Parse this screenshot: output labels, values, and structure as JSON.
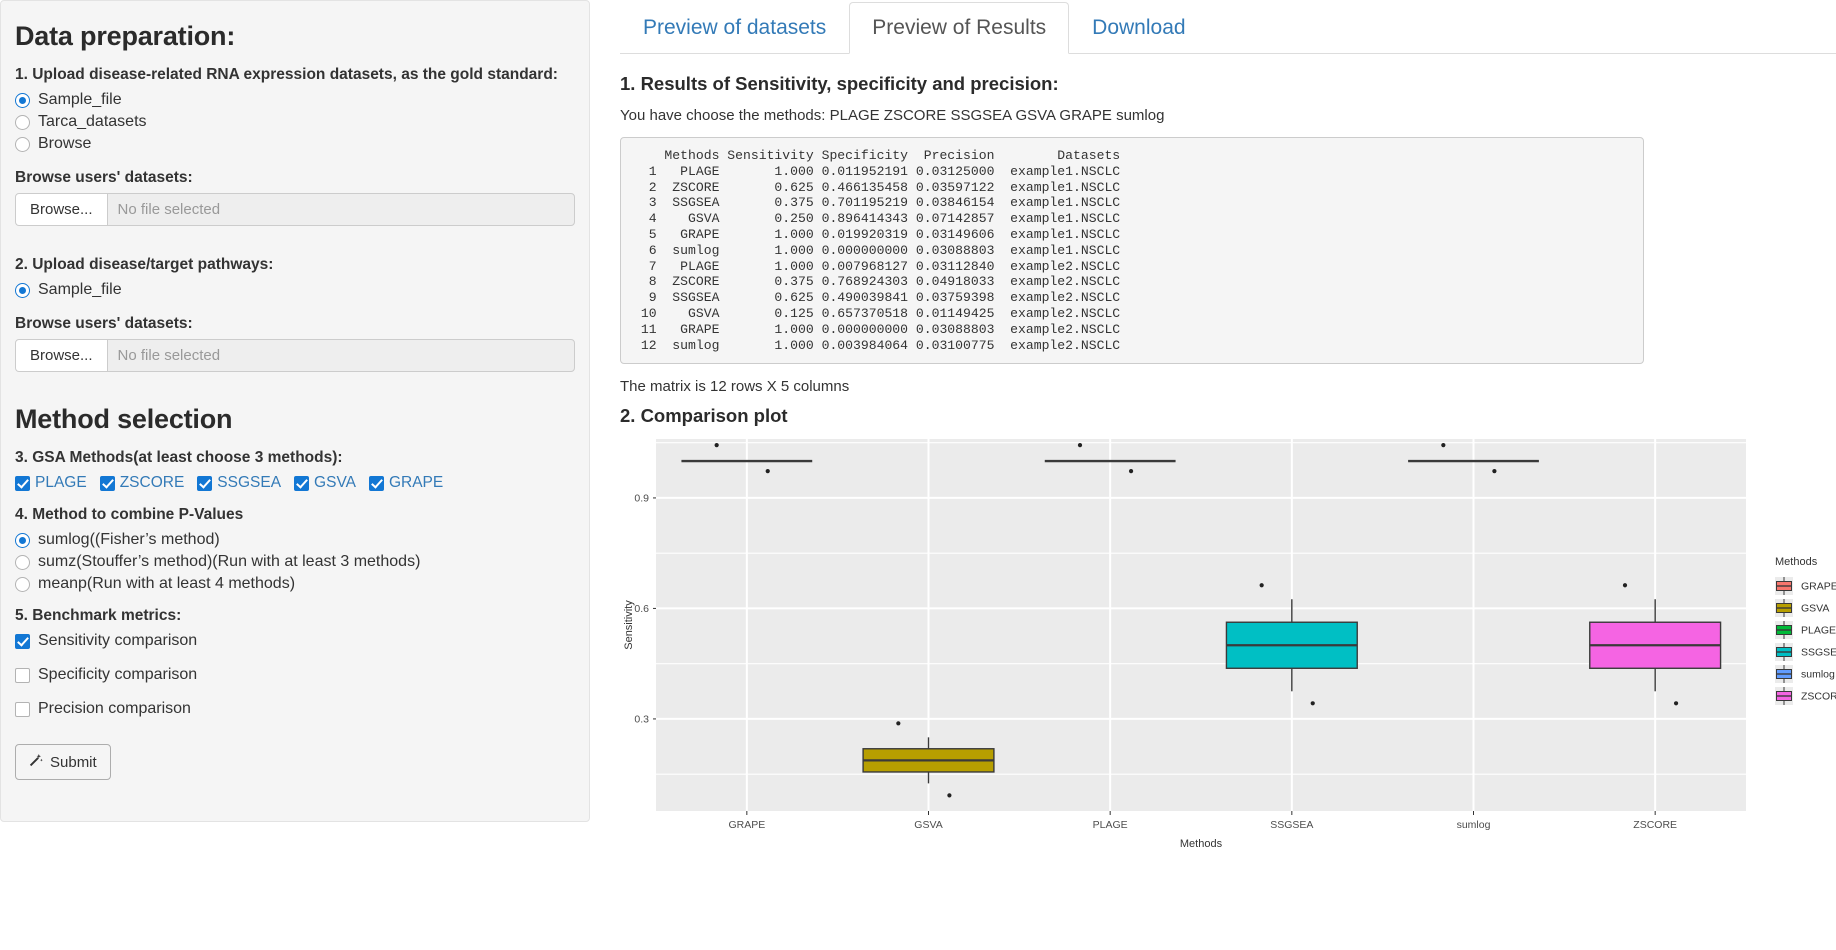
{
  "sidebar": {
    "title": "Data preparation:",
    "q1_label": "1. Upload disease-related RNA expression datasets, as the gold standard:",
    "q1_options": [
      {
        "label": "Sample_file",
        "selected": true
      },
      {
        "label": "Tarca_datasets",
        "selected": false
      },
      {
        "label": "Browse",
        "selected": false
      }
    ],
    "browse1_label": "Browse users' datasets:",
    "browse1_button": "Browse...",
    "browse1_placeholder": "No file selected",
    "q2_label": "2. Upload disease/target pathways:",
    "q2_options": [
      {
        "label": "Sample_file",
        "selected": true
      }
    ],
    "browse2_label": "Browse users' datasets:",
    "browse2_button": "Browse...",
    "browse2_placeholder": "No file selected",
    "method_title": "Method selection",
    "q3_label": "3. GSA Methods(at least choose 3 methods):",
    "q3_options": [
      {
        "label": "PLAGE",
        "checked": true
      },
      {
        "label": "ZSCORE",
        "checked": true
      },
      {
        "label": "SSGSEA",
        "checked": true
      },
      {
        "label": "GSVA",
        "checked": true
      },
      {
        "label": "GRAPE",
        "checked": true
      }
    ],
    "q4_label": "4. Method to combine P-Values",
    "q4_options": [
      {
        "label": "sumlog((Fisher’s method)",
        "selected": true
      },
      {
        "label": "sumz(Stouffer’s method)(Run with at least 3 methods)",
        "selected": false
      },
      {
        "label": "meanp(Run with at least 4 methods)",
        "selected": false
      }
    ],
    "q5_label": "5. Benchmark metrics:",
    "q5_options": [
      {
        "label": "Sensitivity comparison",
        "checked": true
      },
      {
        "label": "Specificity comparison",
        "checked": false
      },
      {
        "label": "Precision comparison",
        "checked": false
      }
    ],
    "submit_label": "Submit",
    "submit_icon": "wand-icon"
  },
  "tabs": [
    {
      "label": "Preview of datasets",
      "active": false
    },
    {
      "label": "Preview of Results",
      "active": true
    },
    {
      "label": "Download",
      "active": false
    }
  ],
  "results": {
    "heading": "1. Results of Sensitivity, specificity and precision:",
    "methods_note": "You have choose the methods: PLAGE ZSCORE SSGSEA GSVA GRAPE sumlog",
    "matrix_note": "The matrix is 12 rows X 5 columns",
    "table": {
      "columns": [
        "",
        "Methods",
        "Sensitivity",
        "Specificity",
        "Precision",
        "Datasets"
      ],
      "rows": [
        [
          "1",
          "PLAGE",
          "1.000",
          "0.011952191",
          "0.03125000",
          "example1.NSCLC"
        ],
        [
          "2",
          "ZSCORE",
          "0.625",
          "0.466135458",
          "0.03597122",
          "example1.NSCLC"
        ],
        [
          "3",
          "SSGSEA",
          "0.375",
          "0.701195219",
          "0.03846154",
          "example1.NSCLC"
        ],
        [
          "4",
          "GSVA",
          "0.250",
          "0.896414343",
          "0.07142857",
          "example1.NSCLC"
        ],
        [
          "5",
          "GRAPE",
          "1.000",
          "0.019920319",
          "0.03149606",
          "example1.NSCLC"
        ],
        [
          "6",
          "sumlog",
          "1.000",
          "0.000000000",
          "0.03088803",
          "example1.NSCLC"
        ],
        [
          "7",
          "PLAGE",
          "1.000",
          "0.007968127",
          "0.03112840",
          "example2.NSCLC"
        ],
        [
          "8",
          "ZSCORE",
          "0.375",
          "0.768924303",
          "0.04918033",
          "example2.NSCLC"
        ],
        [
          "9",
          "SSGSEA",
          "0.625",
          "0.490039841",
          "0.03759398",
          "example2.NSCLC"
        ],
        [
          "10",
          "GSVA",
          "0.125",
          "0.657370518",
          "0.01149425",
          "example2.NSCLC"
        ],
        [
          "11",
          "GRAPE",
          "1.000",
          "0.000000000",
          "0.03088803",
          "example2.NSCLC"
        ],
        [
          "12",
          "sumlog",
          "1.000",
          "0.003984064",
          "0.03100775",
          "example2.NSCLC"
        ]
      ]
    }
  },
  "plot": {
    "heading": "2. Comparison plot",
    "legend_title": "Methods"
  },
  "chart_data": {
    "type": "boxplot",
    "title": "",
    "xlabel": "Methods",
    "ylabel": "Sensitivity",
    "categories": [
      "GRAPE",
      "GSVA",
      "PLAGE",
      "SSGSEA",
      "sumlog",
      "ZSCORE"
    ],
    "ylim": [
      0.05,
      1.06
    ],
    "yticks": [
      0.3,
      0.6,
      0.9
    ],
    "ytick_labels": [
      "0.3",
      "0.6",
      "0.9"
    ],
    "grid": true,
    "legend_position": "right",
    "legend_title": "Methods",
    "legend_entries": [
      {
        "name": "GRAPE",
        "color": "#F8766D"
      },
      {
        "name": "GSVA",
        "color": "#B79F00"
      },
      {
        "name": "PLAGE",
        "color": "#00BA38"
      },
      {
        "name": "SSGSEA",
        "color": "#00BFC4"
      },
      {
        "name": "sumlog",
        "color": "#619CFF"
      },
      {
        "name": "ZSCORE",
        "color": "#F564E3"
      }
    ],
    "boxes": [
      {
        "name": "GRAPE",
        "color": "#F8766D",
        "min": 1.0,
        "q1": 1.0,
        "median": 1.0,
        "q3": 1.0,
        "max": 1.0,
        "points": [
          1.0,
          1.0
        ],
        "degenerate": true
      },
      {
        "name": "GSVA",
        "color": "#B79F00",
        "min": 0.125,
        "q1": 0.156,
        "median": 0.1875,
        "q3": 0.219,
        "max": 0.25,
        "points": [
          0.25,
          0.125
        ],
        "degenerate": false
      },
      {
        "name": "PLAGE",
        "color": "#00BA38",
        "min": 1.0,
        "q1": 1.0,
        "median": 1.0,
        "q3": 1.0,
        "max": 1.0,
        "points": [
          1.0,
          1.0
        ],
        "degenerate": true
      },
      {
        "name": "SSGSEA",
        "color": "#00BFC4",
        "min": 0.375,
        "q1": 0.4375,
        "median": 0.5,
        "q3": 0.5625,
        "max": 0.625,
        "points": [
          0.625,
          0.375
        ],
        "degenerate": false
      },
      {
        "name": "sumlog",
        "color": "#619CFF",
        "min": 1.0,
        "q1": 1.0,
        "median": 1.0,
        "q3": 1.0,
        "max": 1.0,
        "points": [
          1.0,
          1.0
        ],
        "degenerate": true
      },
      {
        "name": "ZSCORE",
        "color": "#F564E3",
        "min": 0.375,
        "q1": 0.4375,
        "median": 0.5,
        "q3": 0.5625,
        "max": 0.625,
        "points": [
          0.625,
          0.375
        ],
        "degenerate": false
      }
    ]
  }
}
